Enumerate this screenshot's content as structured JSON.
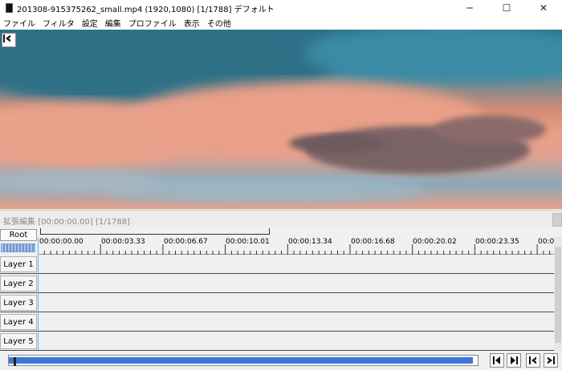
{
  "window": {
    "title": "201308-915375262_small.mp4 (1920,1080)  [1/1788]  デフォルト",
    "minimize_label": "─",
    "maximize_label": "☐",
    "close_label": "✕"
  },
  "menu": {
    "items": [
      "ファイル",
      "フィルタ",
      "設定",
      "編集",
      "プロファイル",
      "表示",
      "その他"
    ]
  },
  "video": {
    "back_icon": "jump-to-start-icon"
  },
  "timeline": {
    "header": "拡張編集 [00:00:00.00] [1/1788]",
    "root_label": "Root",
    "ticks": [
      "00:00:00.00",
      "00:00:03.33",
      "00:00:06.67",
      "00:00:10.01",
      "00:00:13.34",
      "00:00:16.68",
      "00:00:20.02",
      "00:00:23.35",
      "00:00"
    ],
    "layers": [
      "Layer 1",
      "Layer 2",
      "Layer 3",
      "Layer 4",
      "Layer 5"
    ]
  },
  "playback": {
    "progress_fraction": 0.99,
    "buttons": [
      {
        "name": "step-back-icon",
        "glyph": "◀"
      },
      {
        "name": "step-forward-icon",
        "glyph": "▶"
      },
      {
        "name": "go-to-start-icon",
        "glyph": "⇤"
      },
      {
        "name": "go-to-end-icon",
        "glyph": "⇥"
      }
    ]
  },
  "colors": {
    "accent": "#3b78d6",
    "cursor": "#4fb8e8"
  }
}
